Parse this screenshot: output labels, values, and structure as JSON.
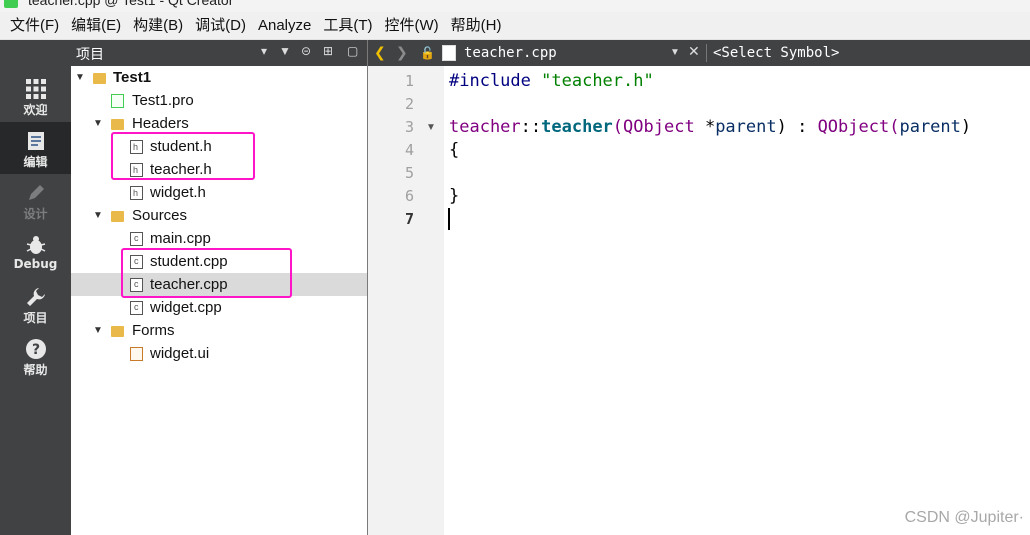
{
  "window": {
    "title": "teacher.cpp @ Test1 - Qt Creator"
  },
  "menu": [
    "文件(F)",
    "编辑(E)",
    "构建(B)",
    "调试(D)",
    "Analyze",
    "工具(T)",
    "控件(W)",
    "帮助(H)"
  ],
  "modes": [
    {
      "label": "欢迎",
      "icon": "grid-icon"
    },
    {
      "label": "编辑",
      "icon": "edit-doc-icon"
    },
    {
      "label": "设计",
      "icon": "pencil-icon"
    },
    {
      "label": "Debug",
      "icon": "bug-icon"
    },
    {
      "label": "项目",
      "icon": "wrench-icon"
    },
    {
      "label": "帮助",
      "icon": "help-icon"
    }
  ],
  "project_pane": {
    "title": "项目"
  },
  "tree": [
    {
      "label": "Test1"
    },
    {
      "label": "Test1.pro"
    },
    {
      "label": "Headers"
    },
    {
      "label": "student.h"
    },
    {
      "label": "teacher.h"
    },
    {
      "label": "widget.h"
    },
    {
      "label": "Sources"
    },
    {
      "label": "main.cpp"
    },
    {
      "label": "student.cpp"
    },
    {
      "label": "teacher.cpp"
    },
    {
      "label": "widget.cpp"
    },
    {
      "label": "Forms"
    },
    {
      "label": "widget.ui"
    }
  ],
  "editor": {
    "filename": "teacher.cpp",
    "symbol": "<Select Symbol>",
    "line_numbers": [
      "1",
      "2",
      "3",
      "4",
      "5",
      "6",
      "7"
    ],
    "code": {
      "l1_directive": "#include",
      "l1_string": "\"teacher.h\"",
      "l3_class": "teacher",
      "l3_scope": "::",
      "l3_func": "teacher",
      "l3_open": "(",
      "l3_ptype": "QObject",
      "l3_star": " *",
      "l3_pname": "parent",
      "l3_close": ") : ",
      "l3_base": "QObject",
      "l3_open2": "(",
      "l3_arg": "parent",
      "l3_close2": ")",
      "l4": "{",
      "l6": "}"
    }
  },
  "watermark": "CSDN @Jupiter·",
  "colors": {
    "highlight": "#ff14c8",
    "modebar": "#404244"
  }
}
